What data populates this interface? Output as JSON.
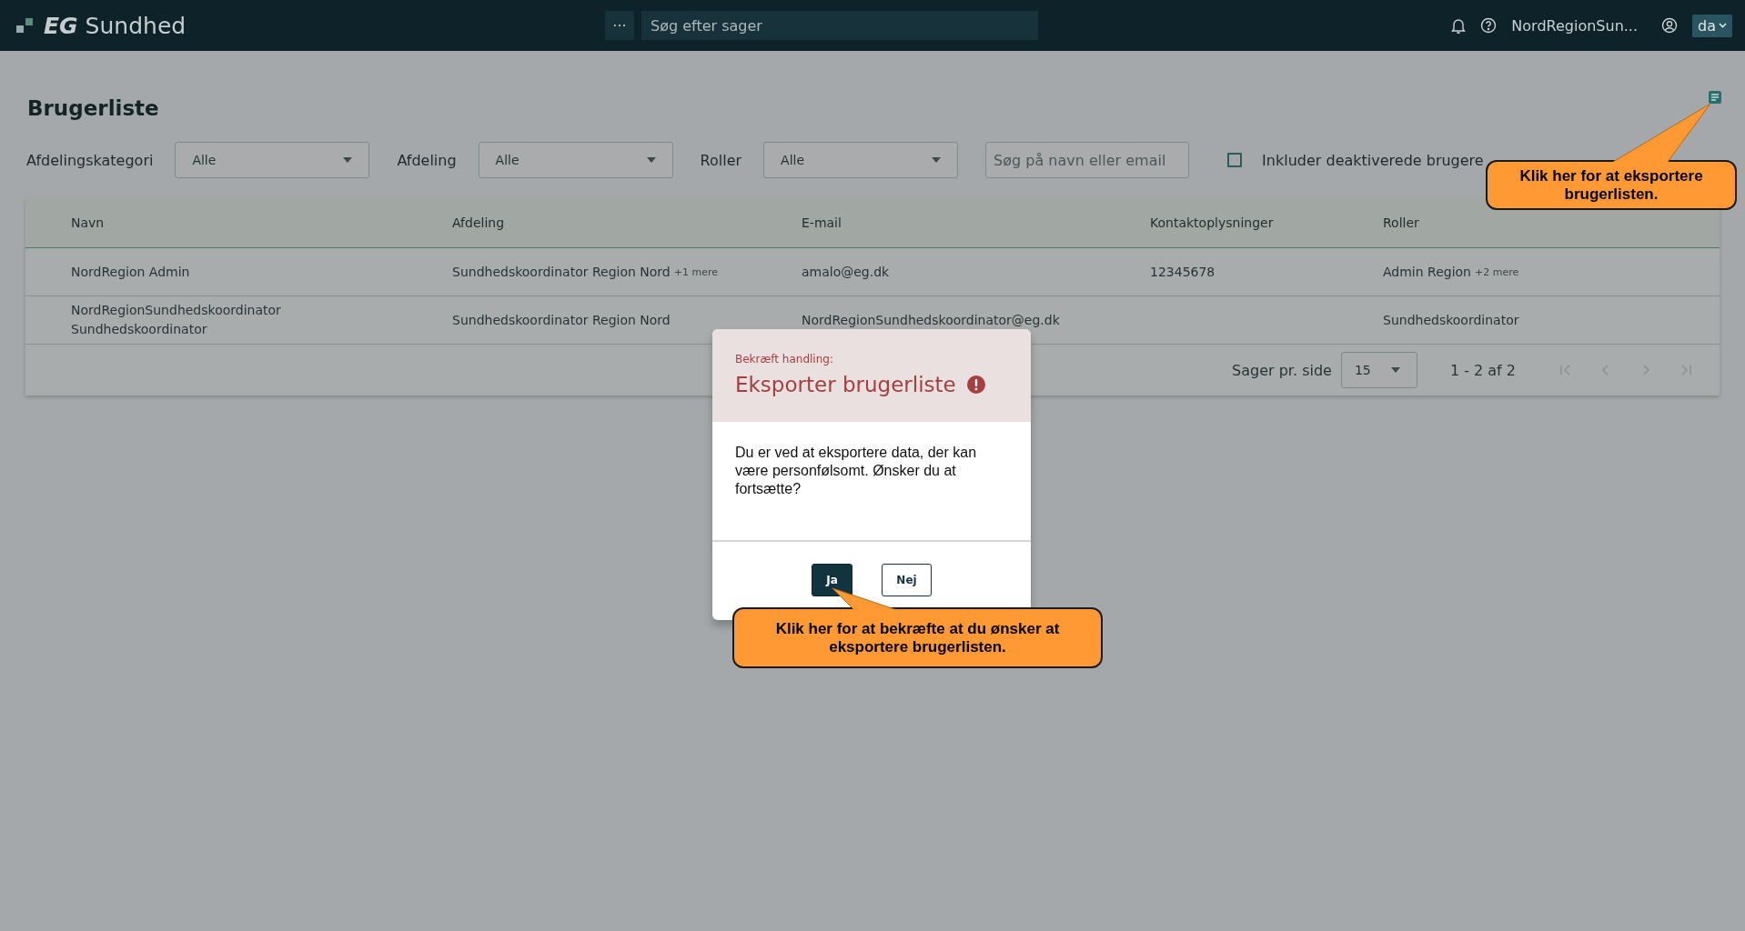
{
  "header": {
    "logo": "EG",
    "product": "Sundhed",
    "menu_button": "···",
    "search": {
      "placeholder": "Søg efter sager"
    },
    "user": "NordRegionSun...",
    "language": "da"
  },
  "page": {
    "title": "Brugerliste"
  },
  "filters": [
    {
      "kind": "select",
      "label": "Afdelingskategori",
      "value": "Alle"
    },
    {
      "kind": "select",
      "label": "Afdeling",
      "value": "Alle"
    },
    {
      "kind": "select",
      "label": "Roller",
      "value": "Alle"
    },
    {
      "kind": "search",
      "placeholder": "Søg på navn eller email"
    },
    {
      "kind": "checkbox",
      "label": "Inkluder deaktiverede brugere",
      "checked": false
    }
  ],
  "table": {
    "columns": [
      "Navn",
      "Afdeling",
      "E-mail",
      "Kontaktoplysninger",
      "Roller"
    ],
    "rows": [
      {
        "cells": [
          {
            "text": "NordRegion Admin"
          },
          {
            "text": "Sundhedskoordinator Region Nord",
            "more": "+1 mere"
          },
          {
            "text": "amalo@eg.dk"
          },
          {
            "text": "12345678"
          },
          {
            "text": "Admin Region",
            "more": "+2 mere"
          }
        ]
      },
      {
        "cells": [
          {
            "text": "NordRegionSundhedskoordinator Sundhedskoordinator"
          },
          {
            "text": "Sundhedskoordinator Region Nord"
          },
          {
            "text": "NordRegionSundhedskoordinator@eg.dk"
          },
          {},
          {
            "text": "Sundhedskoordinator"
          }
        ]
      }
    ],
    "pagination": {
      "label": "Sager pr. side",
      "page_size": "15",
      "range": "1 - 2 af 2"
    }
  },
  "dialog": {
    "overline": "Bekræft handling:",
    "title": "Eksporter brugerliste",
    "message": "Du er ved at eksportere data, der kan være personfølsomt. Ønsker du at fortsætte?",
    "buttons": [
      {
        "label": "Ja",
        "primary": true
      },
      {
        "label": "Nej",
        "primary": false
      }
    ]
  },
  "callouts": [
    {
      "text": "Klik her for at eksportere brugerlisten."
    },
    {
      "text": "Klik her for at bekræfte at du ønsker at eksportere brugerlisten."
    }
  ]
}
